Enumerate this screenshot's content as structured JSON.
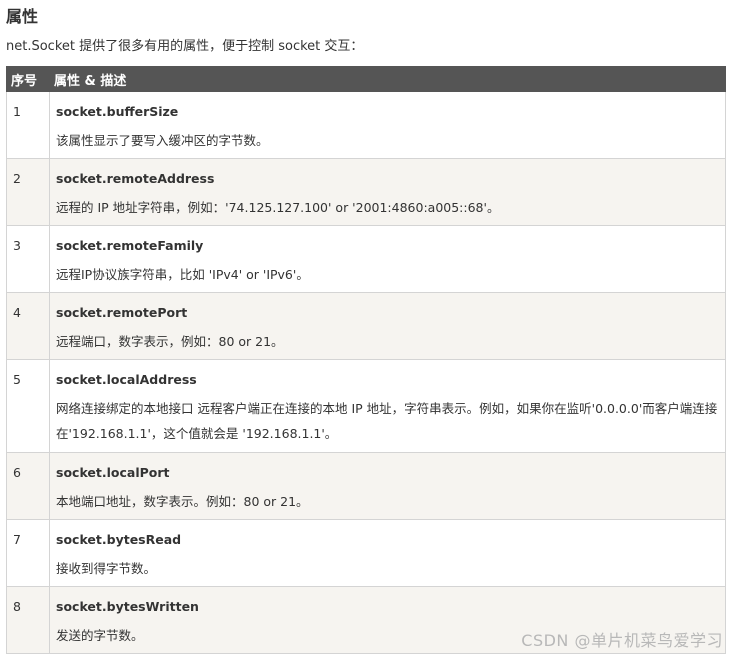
{
  "page": {
    "heading": "属性",
    "intro": "net.Socket 提供了很多有用的属性，便于控制 socket 交互：",
    "watermark": "CSDN @单片机菜鸟爱学习"
  },
  "table": {
    "headers": {
      "index": "序号",
      "desc": "属性 & 描述"
    },
    "rows": [
      {
        "index": "1",
        "name": "socket.bufferSize",
        "desc": "该属性显示了要写入缓冲区的字节数。"
      },
      {
        "index": "2",
        "name": "socket.remoteAddress",
        "desc": "远程的 IP 地址字符串，例如：'74.125.127.100' or '2001:4860:a005::68'。"
      },
      {
        "index": "3",
        "name": "socket.remoteFamily",
        "desc": "远程IP协议族字符串，比如 'IPv4' or 'IPv6'。"
      },
      {
        "index": "4",
        "name": "socket.remotePort",
        "desc": "远程端口，数字表示，例如：80 or 21。"
      },
      {
        "index": "5",
        "name": "socket.localAddress",
        "desc": "网络连接绑定的本地接口 远程客户端正在连接的本地 IP 地址，字符串表示。例如，如果你在监听'0.0.0.0'而客户端连接在'192.168.1.1'，这个值就会是 '192.168.1.1'。"
      },
      {
        "index": "6",
        "name": "socket.localPort",
        "desc": "本地端口地址，数字表示。例如：80 or 21。"
      },
      {
        "index": "7",
        "name": "socket.bytesRead",
        "desc": "接收到得字节数。"
      },
      {
        "index": "8",
        "name": "socket.bytesWritten",
        "desc": "发送的字节数。"
      }
    ]
  }
}
